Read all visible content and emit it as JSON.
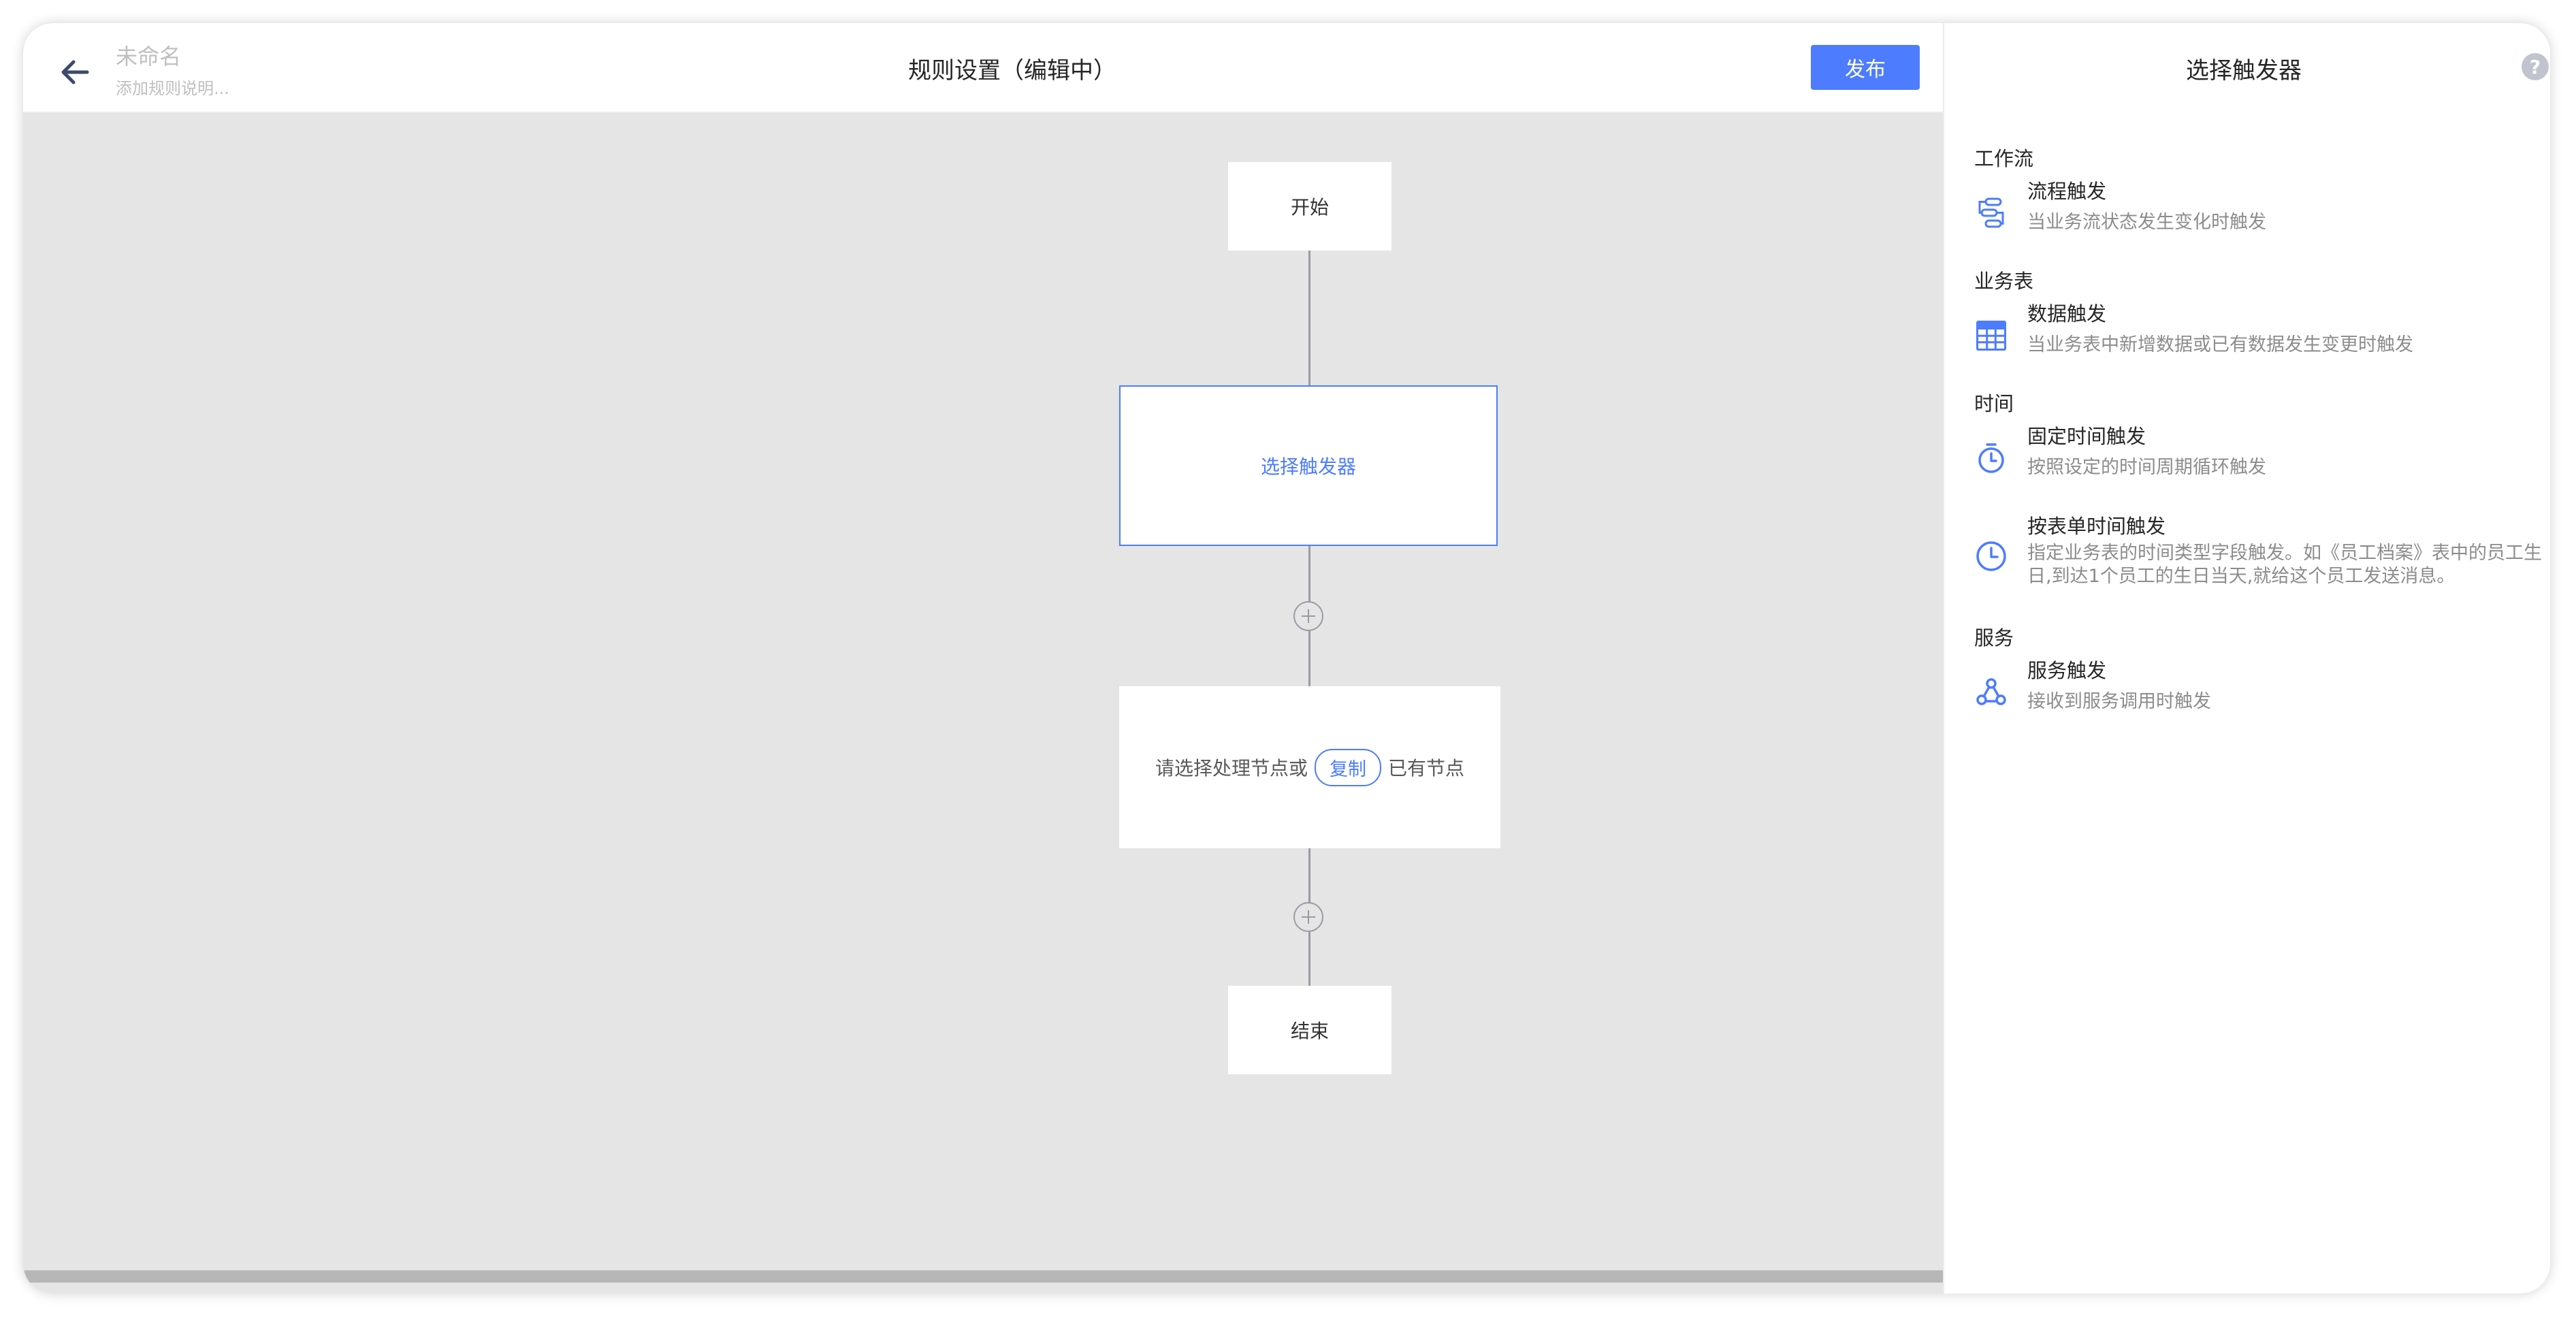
{
  "header": {
    "rule_name_placeholder": "未命名",
    "rule_desc_placeholder": "添加规则说明...",
    "title": "规则设置（编辑中）",
    "publish_label": "发布"
  },
  "flow": {
    "start_label": "开始",
    "trigger_label": "选择触发器",
    "process_prefix": "请选择处理节点或",
    "process_copy": "复制",
    "process_suffix": "已有节点",
    "end_label": "结束"
  },
  "panel": {
    "title": "选择触发器",
    "help_icon": "?",
    "sections": [
      {
        "label": "工作流",
        "options": [
          {
            "title": "流程触发",
            "desc": "当业务流状态发生变化时触发",
            "icon": "workflow-icon"
          }
        ]
      },
      {
        "label": "业务表",
        "options": [
          {
            "title": "数据触发",
            "desc": "当业务表中新增数据或已有数据发生变更时触发",
            "icon": "table-icon"
          }
        ]
      },
      {
        "label": "时间",
        "options": [
          {
            "title": "固定时间触发",
            "desc": "按照设定的时间周期循环触发",
            "icon": "stopwatch-icon"
          },
          {
            "title": "按表单时间触发",
            "desc": "指定业务表的时间类型字段触发。如《员工档案》表中的员工生日,到达1个员工的生日当天,就给这个员工发送消息。",
            "icon": "clock-icon"
          }
        ]
      },
      {
        "label": "服务",
        "options": [
          {
            "title": "服务触发",
            "desc": "接收到服务调用时触发",
            "icon": "webhook-icon"
          }
        ]
      }
    ]
  },
  "colors": {
    "accent": "#4d7cfe",
    "canvas_bg": "#e5e5e5",
    "connector": "#9a9aa3"
  }
}
